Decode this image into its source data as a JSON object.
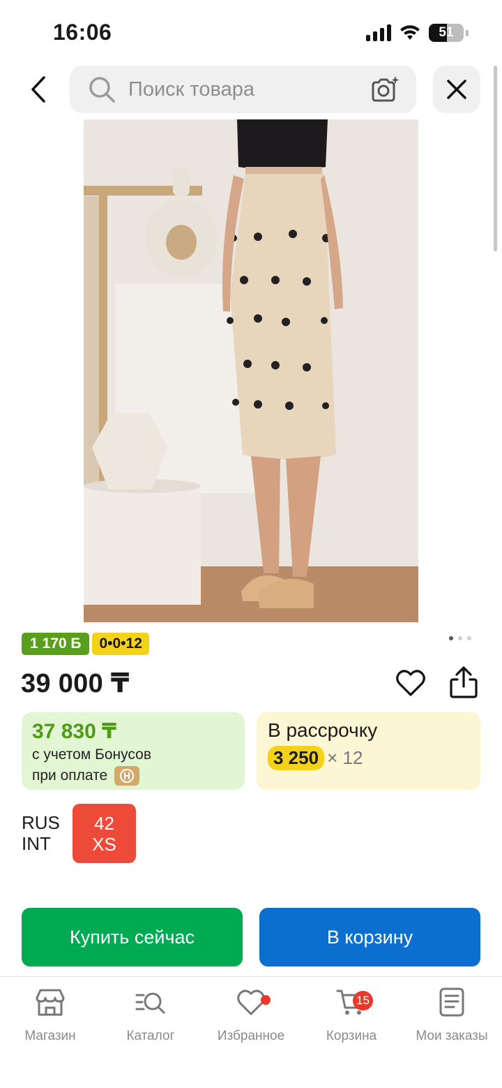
{
  "status_bar": {
    "time": "16:06",
    "battery_level": "51",
    "battery_fraction": 0.51,
    "icons": [
      "cellular-signal-icon",
      "wifi-icon",
      "battery-icon"
    ]
  },
  "header": {
    "back_icon": "chevron-left-icon",
    "search_placeholder": "Поиск товара",
    "search_icon": "search-icon",
    "camera_icon": "camera-search-icon",
    "close_icon": "close-icon"
  },
  "product": {
    "image_alt": "beige midi skirt with black embellishments",
    "bonus_badge": "1 170 Б",
    "installment_badge": "0•0•12",
    "gallery": {
      "count": 3,
      "active": 0
    },
    "price": "39 000 ₸",
    "favorite_icon": "heart-icon",
    "share_icon": "share-icon"
  },
  "bonus_card": {
    "amount": "37 830 ₸",
    "line1": "с учетом Бонусов",
    "line2": "при оплате",
    "icon": "payment-card-icon"
  },
  "installment_card": {
    "title": "В рассрочку",
    "monthly": "3 250",
    "multiplier": "× 12"
  },
  "size": {
    "labels": [
      "RUS",
      "INT"
    ],
    "selected_rus": "42",
    "selected_int": "XS"
  },
  "actions": {
    "buy_now": "Купить сейчас",
    "add_to_cart": "В корзину"
  },
  "tab_bar": {
    "items": [
      {
        "label": "Магазин",
        "icon": "shop-icon"
      },
      {
        "label": "Каталог",
        "icon": "catalog-search-icon"
      },
      {
        "label": "Избранное",
        "icon": "heart-icon"
      },
      {
        "label": "Корзина",
        "icon": "cart-icon",
        "badge": "15"
      },
      {
        "label": "Мои заказы",
        "icon": "orders-icon"
      }
    ]
  },
  "colors": {
    "green_accent": "#00aa52",
    "blue_accent": "#0b6fcf",
    "size_selected": "#ee4a3a",
    "bonus_green": "#5a9e1d",
    "installment_yellow": "#f5d21a",
    "badge_red": "#e8392b"
  }
}
